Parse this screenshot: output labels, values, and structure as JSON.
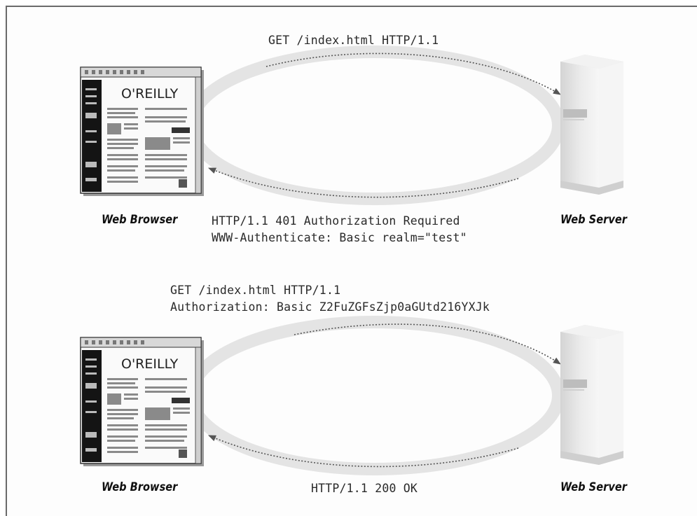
{
  "exchanges": [
    {
      "request_lines": [
        "GET /index.html HTTP/1.1"
      ],
      "response_lines": [
        "HTTP/1.1 401 Authorization Required",
        "WWW-Authenticate: Basic realm=\"test\""
      ],
      "client_label": "Web Browser",
      "server_label": "Web Server",
      "logo_text": "O'REILLY"
    },
    {
      "request_lines": [
        "GET /index.html HTTP/1.1",
        "Authorization: Basic Z2FuZGFsZjp0aGUtd216YXJk"
      ],
      "response_lines": [
        "HTTP/1.1 200 OK"
      ],
      "client_label": "Web Browser",
      "server_label": "Web Server",
      "logo_text": "O'REILLY"
    }
  ],
  "colors": {
    "ring": "#e4e4e4",
    "arrow": "#555555",
    "text": "#2a2a2a"
  }
}
